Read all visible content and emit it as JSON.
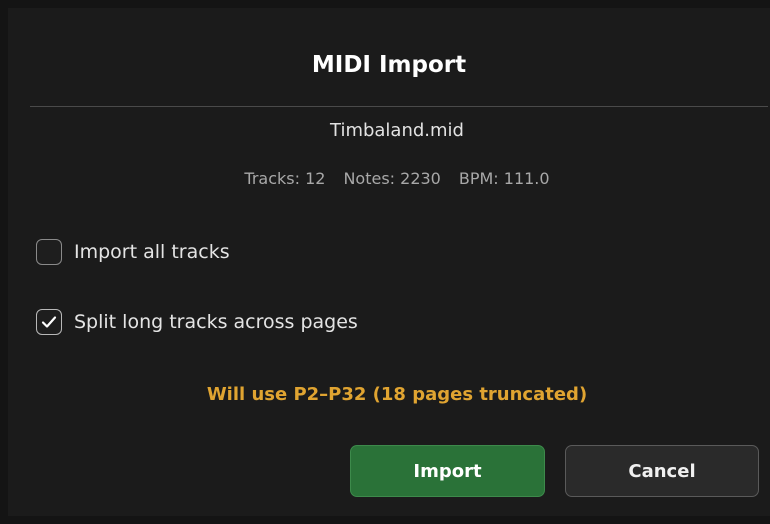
{
  "dialog": {
    "title": "MIDI Import",
    "filename": "Timbaland.mid",
    "stats": {
      "tracks": "Tracks: 12",
      "notes": "Notes: 2230",
      "bpm": "BPM: 111.0"
    },
    "options": [
      {
        "label": "Import all tracks",
        "checked": false
      },
      {
        "label": "Split long tracks across pages",
        "checked": true
      }
    ],
    "warning": "Will use P2–P32 (18 pages truncated)",
    "buttons": {
      "import_label": "Import",
      "cancel_label": "Cancel"
    },
    "colors": {
      "background": "#1b1b1b",
      "warning": "#e0a431",
      "import_button": "#2a7238"
    }
  }
}
